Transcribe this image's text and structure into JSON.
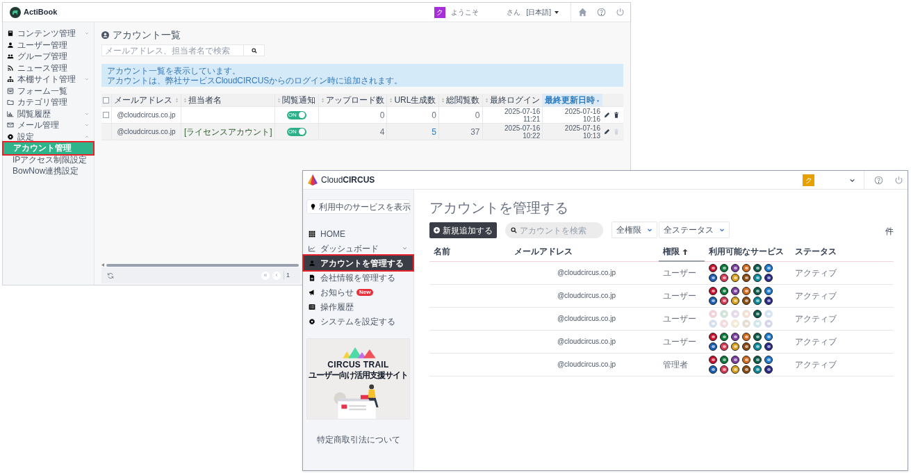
{
  "actibook": {
    "logo": "ActiBook",
    "header": {
      "avatar": "ク",
      "welcome": "ようこそ",
      "honorific": "さん",
      "language": "[日本語]"
    },
    "sidebar": [
      {
        "label": "コンテンツ管理",
        "expanded": false
      },
      {
        "label": "ユーザー管理"
      },
      {
        "label": "グループ管理"
      },
      {
        "label": "ニュース管理"
      },
      {
        "label": "本棚サイト管理",
        "expanded": false
      },
      {
        "label": "フォーム一覧"
      },
      {
        "label": "カテゴリ管理"
      },
      {
        "label": "閲覧履歴",
        "expanded": false
      },
      {
        "label": "メール管理",
        "expanded": false
      },
      {
        "label": "設定",
        "expanded": true,
        "children": [
          {
            "label": "アカウント管理",
            "selected": true
          },
          {
            "label": "IPアクセス制限設定",
            "selected": false
          },
          {
            "label": "BowNow連携設定",
            "selected": false
          }
        ]
      }
    ],
    "title": "アカウント一覧",
    "search": {
      "placeholder": "メールアドレス、担当者名で検索"
    },
    "info": [
      "アカウント一覧を表示しています。",
      "アカウントは、弊社サービスCloudCIRCUSからのログイン時に追加されます。"
    ],
    "table": {
      "select_all": {
        "checked": false
      },
      "columns": [
        {
          "label": "メールアドレス",
          "sorted": false
        },
        {
          "label": "担当者名",
          "sorted": false
        },
        {
          "label": "閲覧通知",
          "sorted": false
        },
        {
          "label": "アップロード数",
          "sorted": false
        },
        {
          "label": "URL生成数",
          "sorted": false
        },
        {
          "label": "総閲覧数",
          "sorted": false
        },
        {
          "label": "最終ログイン",
          "sorted": false
        },
        {
          "label": "最終更新日時",
          "sorted": true
        }
      ],
      "rows": [
        {
          "checkbox": {
            "checked": false
          },
          "email": "@cloudcircus.co.jp",
          "name": "",
          "notify": {
            "on": true,
            "label": "ON"
          },
          "uploads": "0",
          "urls": "0",
          "urls_linked": false,
          "views": "0",
          "last_login_date": "2025-07-16",
          "last_login_time": "11:21",
          "updated_date": "2025-07-16",
          "updated_time": "10:16",
          "deletable": true
        },
        {
          "email": "@cloudcircus.co.jp",
          "name": "[ライセンスアカウント]",
          "notify": {
            "on": true,
            "label": "ON"
          },
          "uploads": "4",
          "urls": "5",
          "urls_linked": true,
          "views": "37",
          "last_login_date": "2025-07-16",
          "last_login_time": "10:22",
          "updated_date": "2025-07-16",
          "updated_time": "10:13",
          "deletable": false
        }
      ]
    },
    "pagination": {
      "first": "«",
      "prev": "‹",
      "page": "1"
    }
  },
  "cloudcircus": {
    "logo": "Cloud**CIRCUS**",
    "avatar": "ク",
    "service_button": "利用中のサービスを表示",
    "nav": [
      {
        "label": "HOME",
        "selected": false
      },
      {
        "label": "ダッシュボード",
        "selected": false,
        "expanded": false
      },
      {
        "label": "アカウントを管理する",
        "selected": true
      },
      {
        "label": "会社情報を管理する",
        "selected": false
      },
      {
        "label": "お知らせ",
        "selected": false,
        "badge": "New"
      },
      {
        "label": "操作履歴",
        "selected": false
      },
      {
        "label": "システムを設定する",
        "selected": false
      }
    ],
    "banner": {
      "title": "CIRCUS TRAIL",
      "subtitle": "ユーザー向け活用支援サイト"
    },
    "footer_link": "特定商取引法について",
    "title": "アカウントを管理する",
    "add_button": "新規追加する",
    "search": {
      "placeholder": "アカウントを検索"
    },
    "filters": [
      "全権限",
      "全ステータス"
    ],
    "count_unit": "件",
    "table": {
      "columns": [
        {
          "label": "名前",
          "sorted": false
        },
        {
          "label": "メールアドレス",
          "sorted": false
        },
        {
          "label": "権限",
          "sorted": true
        },
        {
          "label": "利用可能なサービス",
          "sorted": false
        },
        {
          "label": "ステータス",
          "sorted": false
        }
      ],
      "rows": [
        {
          "email": "@cloudcircus.co.jp",
          "role": "ユーザー",
          "status": "アクティブ",
          "services": [
            {
              "color": "#c8102e",
              "enabled": true
            },
            {
              "color": "#0a7a3a",
              "enabled": true
            },
            {
              "color": "#7b3fa0",
              "enabled": true
            },
            {
              "color": "#d06a1a",
              "enabled": true
            },
            {
              "color": "#0c5c4c",
              "enabled": true
            },
            {
              "color": "#1a7ad0",
              "enabled": true
            },
            {
              "color": "#1b5fb5",
              "enabled": true
            },
            {
              "color": "#d63a55",
              "enabled": true
            },
            {
              "color": "#d9a21a",
              "enabled": true
            },
            {
              "color": "#8a4a10",
              "enabled": true
            },
            {
              "color": "#0a8a9a",
              "enabled": true
            },
            {
              "color": "#2a2a8a",
              "enabled": true
            }
          ]
        },
        {
          "email": "@cloudcircus.co.jp",
          "role": "ユーザー",
          "status": "アクティブ",
          "services": [
            {
              "color": "#c8102e",
              "enabled": true
            },
            {
              "color": "#0a7a3a",
              "enabled": true
            },
            {
              "color": "#7b3fa0",
              "enabled": true
            },
            {
              "color": "#d06a1a",
              "enabled": true
            },
            {
              "color": "#0c5c4c",
              "enabled": true
            },
            {
              "color": "#1a7ad0",
              "enabled": true
            },
            {
              "color": "#1b5fb5",
              "enabled": true
            },
            {
              "color": "#d63a55",
              "enabled": true
            },
            {
              "color": "#d9a21a",
              "enabled": true
            },
            {
              "color": "#8a4a10",
              "enabled": true
            },
            {
              "color": "#0a8a9a",
              "enabled": true
            },
            {
              "color": "#2a2a8a",
              "enabled": true
            }
          ]
        },
        {
          "email": "@cloudcircus.co.jp",
          "role": "ユーザー",
          "status": "アクティブ",
          "services": [
            {
              "color": "#f4cfd5",
              "enabled": false
            },
            {
              "color": "#cee4d8",
              "enabled": false
            },
            {
              "color": "#e5d9ec",
              "enabled": false
            },
            {
              "color": "#f6e1d1",
              "enabled": false
            },
            {
              "color": "#0c5c4c",
              "enabled": true
            },
            {
              "color": "#d1e4f6",
              "enabled": false
            },
            {
              "color": "#d1dff0",
              "enabled": false
            },
            {
              "color": "#f7d8dd",
              "enabled": false
            },
            {
              "color": "#f7ecd1",
              "enabled": false
            },
            {
              "color": "#e8dbcf",
              "enabled": false
            },
            {
              "color": "#cee8eb",
              "enabled": false
            },
            {
              "color": "#d4d4e8",
              "enabled": false
            }
          ]
        },
        {
          "email": "@cloudcircus.co.jp",
          "role": "ユーザー",
          "status": "アクティブ",
          "services": [
            {
              "color": "#c8102e",
              "enabled": true
            },
            {
              "color": "#0a7a3a",
              "enabled": true
            },
            {
              "color": "#7b3fa0",
              "enabled": true
            },
            {
              "color": "#d06a1a",
              "enabled": true
            },
            {
              "color": "#0c5c4c",
              "enabled": true
            },
            {
              "color": "#1a7ad0",
              "enabled": true
            },
            {
              "color": "#1b5fb5",
              "enabled": true
            },
            {
              "color": "#d63a55",
              "enabled": true
            },
            {
              "color": "#d9a21a",
              "enabled": true
            },
            {
              "color": "#8a4a10",
              "enabled": true
            },
            {
              "color": "#0a8a9a",
              "enabled": true
            },
            {
              "color": "#2a2a8a",
              "enabled": true
            }
          ]
        },
        {
          "email": "@cloudcircus.co.jp",
          "role": "管理者",
          "status": "アクティブ",
          "services": [
            {
              "color": "#c8102e",
              "enabled": true
            },
            {
              "color": "#0a7a3a",
              "enabled": true
            },
            {
              "color": "#7b3fa0",
              "enabled": true
            },
            {
              "color": "#d06a1a",
              "enabled": true
            },
            {
              "color": "#0c5c4c",
              "enabled": true
            },
            {
              "color": "#1a7ad0",
              "enabled": true
            },
            {
              "color": "#1b5fb5",
              "enabled": true
            },
            {
              "color": "#d63a55",
              "enabled": true
            },
            {
              "color": "#d9a21a",
              "enabled": true
            },
            {
              "color": "#8a4a10",
              "enabled": true
            },
            {
              "color": "#0a8a9a",
              "enabled": true
            },
            {
              "color": "#2a2a8a",
              "enabled": true
            }
          ]
        }
      ]
    }
  }
}
